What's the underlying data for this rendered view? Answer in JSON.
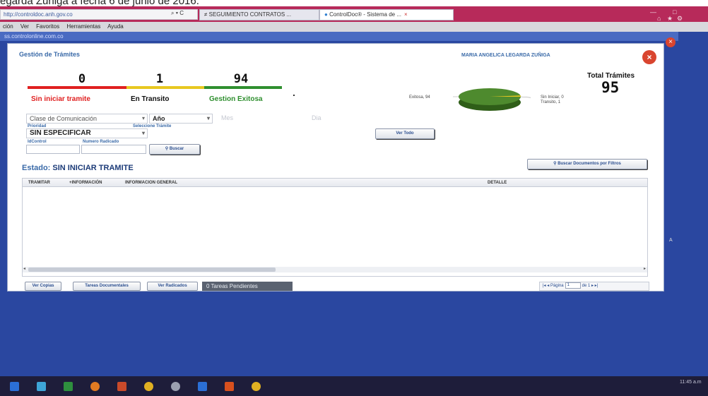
{
  "doc_caption": "egarda Zuñiga a fecha 6 de junio de 2016.",
  "browser": {
    "address": "http://controldoc.anh.gov.co",
    "address_controls": "⌕ ▾ C",
    "tabs": [
      {
        "label": "≠ SEGUIMIENTO CONTRATOS ...",
        "active": false
      },
      {
        "label": "ControlDoc® - Sistema de ...",
        "active": true
      }
    ],
    "menu": [
      "ción",
      "Ver",
      "Favoritos",
      "Herramientas",
      "Ayuda"
    ],
    "link_bar": "ss.controlonline.com.co"
  },
  "app": {
    "title": "Gestión de Trámites",
    "user": "MARIA ANGELICA LEGARDA ZUÑIGA",
    "counters": [
      {
        "value": "0",
        "label": "Sin iniciar tramite",
        "color": "#e02020"
      },
      {
        "value": "1",
        "label": "En Transito",
        "color": "#e8c820"
      },
      {
        "value": "94",
        "label": "Gestion Exitosa",
        "color": "#2f8f2f"
      }
    ],
    "total_label": "Total Trámites",
    "total_value": "95",
    "pie": {
      "left_label": "Exitosa, 94",
      "right_label_1": "Sin Iniciar, 0",
      "right_label_2": "Transito, 1",
      "slices": [
        {
          "name": "Exitosa",
          "value": 94,
          "color": "#4e8a2e"
        },
        {
          "name": "Transito",
          "value": 1,
          "color": "#e8c820"
        },
        {
          "name": "Sin Iniciar",
          "value": 0,
          "color": "#e02020"
        }
      ]
    },
    "filters": {
      "comunicacion": "Clase de Comunicación",
      "anio": "Año",
      "mes": "Mes",
      "dia": "Dia",
      "prioridad_label": "Prioridad",
      "prioridad_value": "SIN ESPECIFICAR",
      "tramite_label": "Seleccione Trámite",
      "idcontrol_label": "IdControl",
      "radicado_label": "Numero Radicado",
      "buscar": "Buscar",
      "ver_todo": "Ver Todo",
      "buscar_filtros": "Buscar Documentos por Filtros"
    },
    "estado_prefix": "Estado:",
    "estado_value": "SIN INICIAR TRAMITE",
    "grid_columns": [
      "TRAMITAR",
      "+INFORMACIÓN",
      "INFORMACION GENERAL",
      "DETALLE"
    ],
    "footer": {
      "ver_copias": "Ver Copias",
      "tareas_documentales": "Tareas Documentales",
      "ver_radicados": "Ver Radicados",
      "pendientes": "0 Tareas Pendientes",
      "pager_page_label": "Página",
      "pager_page_value": "1",
      "pager_of": "de 1"
    }
  },
  "taskbar": {
    "clock": "11:45 a.m"
  }
}
